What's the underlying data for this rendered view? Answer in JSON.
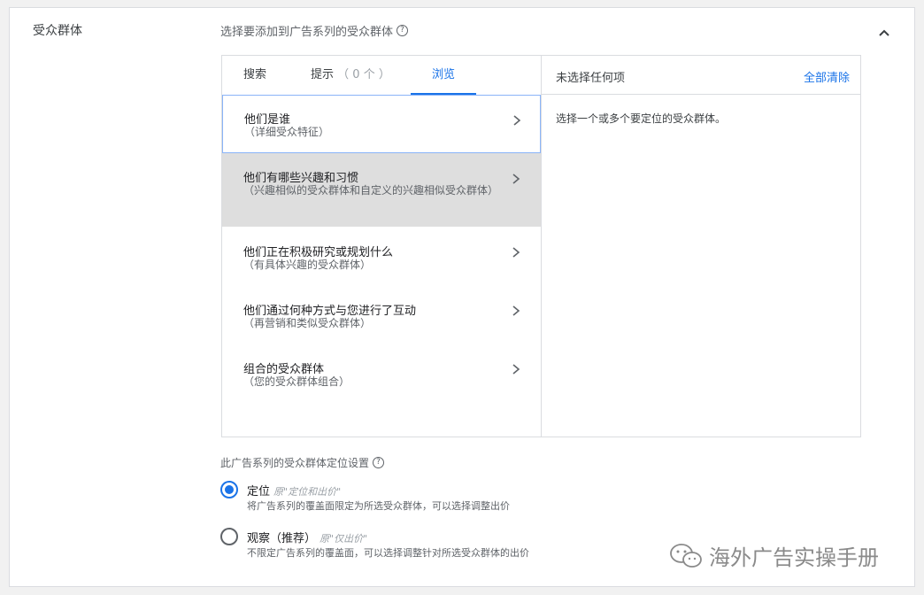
{
  "section": {
    "title": "受众群体"
  },
  "question": "选择要添加到广告系列的受众群体",
  "tabs": {
    "search": "搜索",
    "hint": "提示",
    "hint_count": "（ 0 个 ）",
    "browse": "浏览"
  },
  "browse_items": [
    {
      "title": "他们是谁",
      "subtitle": "（详细受众特征）"
    },
    {
      "title": "他们有哪些兴趣和习惯",
      "subtitle": "（兴趣相似的受众群体和自定义的兴趣相似受众群体）"
    },
    {
      "title": "他们正在积极研究或规划什么",
      "subtitle": "（有具体兴趣的受众群体）"
    },
    {
      "title": "他们通过何种方式与您进行了互动",
      "subtitle": "（再营销和类似受众群体）"
    },
    {
      "title": "组合的受众群体",
      "subtitle": "（您的受众群体组合）"
    }
  ],
  "selection": {
    "none_selected": "未选择任何项",
    "clear_all": "全部清除",
    "message": "选择一个或多个要定位的受众群体。"
  },
  "settings": {
    "label": "此广告系列的受众群体定位设置",
    "options": [
      {
        "title": "定位",
        "original": "原\"定位和出价\"",
        "desc": "将广告系列的覆盖面限定为所选受众群体，可以选择调整出价",
        "checked": true
      },
      {
        "title": "观察（推荐）",
        "original": "原\"仅出价\"",
        "desc": "不限定广告系列的覆盖面，可以选择调整针对所选受众群体的出价",
        "checked": false
      }
    ]
  },
  "watermark": {
    "text": "海外广告实操手册",
    "icon": "wechat-icon"
  },
  "icons": {
    "collapse": "chevron-up-icon",
    "help": "help-circle-icon",
    "item": "chevron-right-icon"
  },
  "colors": {
    "accent": "#1a73e8",
    "hover_bg": "#dedede",
    "border": "#dadce0"
  }
}
